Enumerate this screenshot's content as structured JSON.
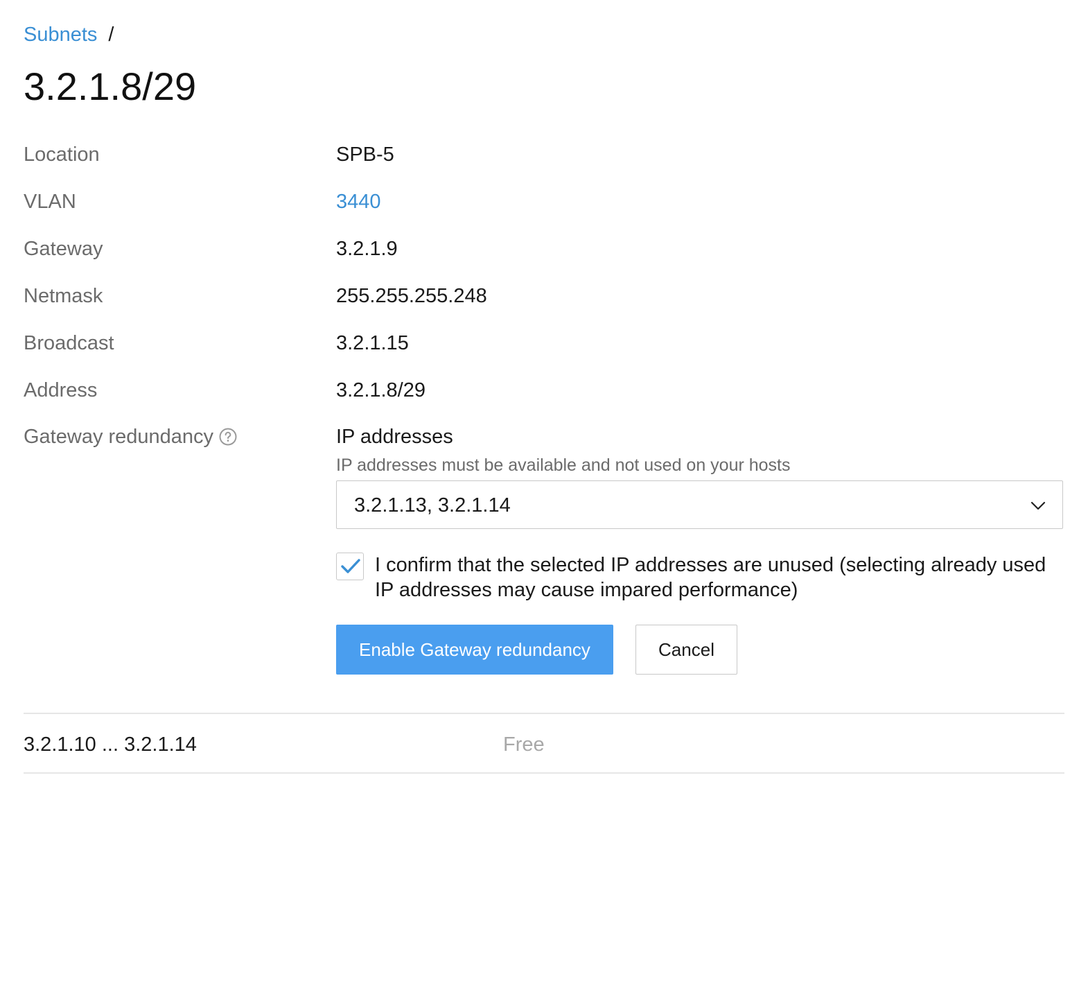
{
  "breadcrumb": {
    "parent_label": "Subnets",
    "separator": "/"
  },
  "page_title": "3.2.1.8/29",
  "details": [
    {
      "label": "Location",
      "value": "SPB-5",
      "is_link": false
    },
    {
      "label": "VLAN",
      "value": "3440",
      "is_link": true
    },
    {
      "label": "Gateway",
      "value": "3.2.1.9",
      "is_link": false
    },
    {
      "label": "Netmask",
      "value": "255.255.255.248",
      "is_link": false
    },
    {
      "label": "Broadcast",
      "value": "3.2.1.15",
      "is_link": false
    },
    {
      "label": "Address",
      "value": "3.2.1.8/29",
      "is_link": false
    }
  ],
  "gateway_redundancy": {
    "label": "Gateway redundancy",
    "help_icon": "question-circle-icon",
    "ip_title": "IP addresses",
    "ip_hint": "IP addresses must be available and not used on your hosts",
    "ip_selected": "3.2.1.13, 3.2.1.14",
    "confirm_checked": true,
    "confirm_text": "I confirm that the selected IP addresses are unused (selecting already used IP addresses may cause impared performance)",
    "enable_label": "Enable Gateway redundancy",
    "cancel_label": "Cancel"
  },
  "ranges": [
    {
      "range": "3.2.1.10 ... 3.2.1.14",
      "status": "Free"
    }
  ],
  "colors": {
    "link": "#3a8fd4",
    "primary_button": "#4a9eef",
    "muted_text": "#6b6b6b",
    "status_free": "#a8a8a8",
    "border": "#c8c8c8"
  }
}
